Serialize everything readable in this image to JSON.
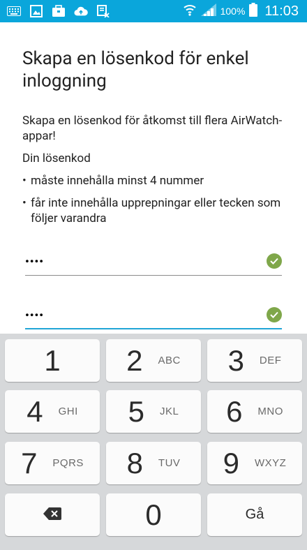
{
  "status_bar": {
    "battery_percent": "100%",
    "time": "11:03",
    "icons": [
      "keyboard-icon",
      "image-icon",
      "briefcase-icon",
      "cloud-upload-icon",
      "screen-off-icon",
      "wifi-icon",
      "signal-icon",
      "battery-icon"
    ]
  },
  "page": {
    "title": "Skapa en lösenkod för enkel inloggning",
    "intro": "Skapa en lösenkod för åtkomst till flera AirWatch-appar!",
    "requirements_caption": "Din lösenkod",
    "requirements": [
      "måste innehålla minst 4 nummer",
      "får inte innehålla upprepningar eller tecken som följer varandra"
    ],
    "bullet_glyph": "•"
  },
  "fields": {
    "passcode_value": "••••",
    "confirm_value": "••••"
  },
  "colors": {
    "status_bar": "#0aa6db",
    "check": "#7fa74a",
    "active_underline": "#21a5d6",
    "keypad_bg": "#d6d8da"
  },
  "keypad": {
    "k1": {
      "num": "1",
      "letters": ""
    },
    "k2": {
      "num": "2",
      "letters": "ABC"
    },
    "k3": {
      "num": "3",
      "letters": "DEF"
    },
    "k4": {
      "num": "4",
      "letters": "GHI"
    },
    "k5": {
      "num": "5",
      "letters": "JKL"
    },
    "k6": {
      "num": "6",
      "letters": "MNO"
    },
    "k7": {
      "num": "7",
      "letters": "PQRS"
    },
    "k8": {
      "num": "8",
      "letters": "TUV"
    },
    "k9": {
      "num": "9",
      "letters": "WXYZ"
    },
    "k0": {
      "num": "0"
    },
    "go_label": "Gå"
  }
}
